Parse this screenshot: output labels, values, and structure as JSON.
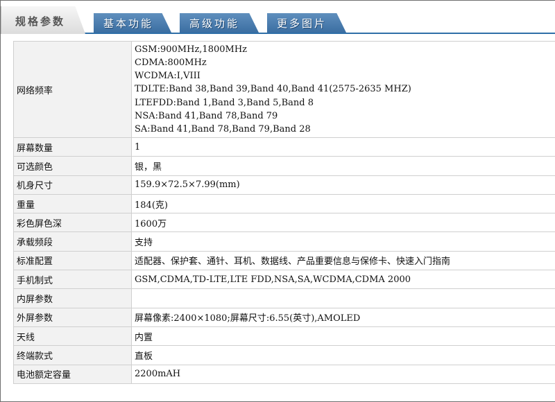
{
  "tabs": [
    {
      "label": "规格参数",
      "active": true
    },
    {
      "label": "基本功能",
      "active": false
    },
    {
      "label": "高级功能",
      "active": false
    },
    {
      "label": "更多图片",
      "active": false
    }
  ],
  "specs": {
    "network": {
      "label": "网络频率",
      "lines": [
        "GSM:900MHz,1800MHz",
        "CDMA:800MHz",
        "WCDMA:I,VIII",
        "TDLTE:Band 38,Band 39,Band 40,Band 41(2575-2635 MHZ)",
        "LTEFDD:Band 1,Band 3,Band 5,Band 8",
        "NSA:Band 41,Band 78,Band 79",
        "SA:Band 41,Band 78,Band 79,Band 28"
      ]
    },
    "rows": [
      {
        "label": "屏幕数量",
        "value": "1"
      },
      {
        "label": "可选颜色",
        "value": "银，黑"
      },
      {
        "label": "机身尺寸",
        "value": "159.9×72.5×7.99(mm)"
      },
      {
        "label": "重量",
        "value": "184(克)"
      },
      {
        "label": "彩色屏色深",
        "value": "1600万"
      },
      {
        "label": "承载频段",
        "value": "支持"
      },
      {
        "label": "标准配置",
        "value": "适配器、保护套、通针、耳机、数据线、产品重要信息与保修卡、快速入门指南"
      },
      {
        "label": "手机制式",
        "value": "GSM,CDMA,TD-LTE,LTE FDD,NSA,SA,WCDMA,CDMA 2000"
      },
      {
        "label": "内屏参数",
        "value": ""
      },
      {
        "label": "外屏参数",
        "value": "屏幕像素:2400×1080;屏幕尺寸:6.55(英寸),AMOLED"
      },
      {
        "label": "天线",
        "value": "内置"
      },
      {
        "label": "终端款式",
        "value": "直板"
      },
      {
        "label": "电池额定容量",
        "value": "2200mAH"
      }
    ]
  }
}
